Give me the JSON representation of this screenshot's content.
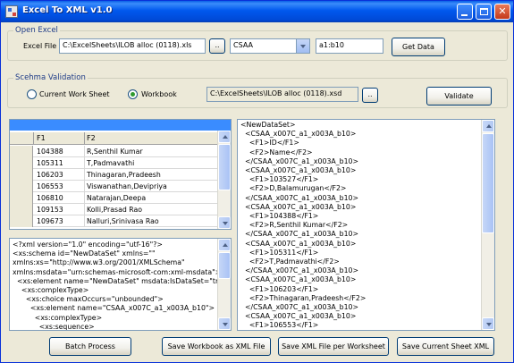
{
  "window": {
    "title": "Excel To XML v1.0"
  },
  "open_excel": {
    "group_title": "Open Excel",
    "file_label": "Excel File",
    "file_path": "C:\\ExcelSheets\\ILOB alloc (0118).xls",
    "browse_label": "..",
    "sheet_selected": "CSAA",
    "range_value": "a1:b10",
    "get_data_label": "Get Data"
  },
  "schema_validation": {
    "group_title": "Scehma Validation",
    "option_current": "Current Work Sheet",
    "option_workbook": "Workbook",
    "selected": "Workbook",
    "xsd_path": "C:\\ExcelSheets\\ILOB alloc (0118).xsd",
    "browse_label": "..",
    "validate_label": "Validate"
  },
  "grid": {
    "columns": [
      "F1",
      "F2"
    ],
    "rows": [
      [
        "104388",
        "R,Senthil Kumar"
      ],
      [
        "105311",
        "T,Padmavathi"
      ],
      [
        "106203",
        "Thinagaran,Pradeesh"
      ],
      [
        "106553",
        "Viswanathan,Devipriya"
      ],
      [
        "106810",
        "Natarajan,Deepa"
      ],
      [
        "109153",
        "Kolli,Prasad Rao"
      ],
      [
        "109673",
        "Nalluri,Srinivasa Rao"
      ]
    ]
  },
  "schema_text": [
    "<?xml version=\"1.0\" encoding=\"utf-16\"?>",
    "<xs:schema id=\"NewDataSet\" xmlns=\"\"",
    "xmlns:xs=\"http://www.w3.org/2001/XMLSchema\"",
    "xmlns:msdata=\"urn:schemas-microsoft-com:xml-msdata\">",
    "  <xs:element name=\"NewDataSet\" msdata:IsDataSet=\"true\">",
    "    <xs:complexType>",
    "      <xs:choice maxOccurs=\"unbounded\">",
    "        <xs:element name=\"CSAA_x007C_a1_x003A_b10\">",
    "          <xs:complexType>",
    "            <xs:sequence>"
  ],
  "xml_text": [
    "<NewDataSet>",
    "  <CSAA_x007C_a1_x003A_b10>",
    "    <F1>ID</F1>",
    "    <F2>Name</F2>",
    "  </CSAA_x007C_a1_x003A_b10>",
    "  <CSAA_x007C_a1_x003A_b10>",
    "    <F1>103527</F1>",
    "    <F2>D,Balamurugan</F2>",
    "  </CSAA_x007C_a1_x003A_b10>",
    "  <CSAA_x007C_a1_x003A_b10>",
    "    <F1>104388</F1>",
    "    <F2>R,Senthil Kumar</F2>",
    "  </CSAA_x007C_a1_x003A_b10>",
    "  <CSAA_x007C_a1_x003A_b10>",
    "    <F1>105311</F1>",
    "    <F2>T,Padmavathi</F2>",
    "  </CSAA_x007C_a1_x003A_b10>",
    "  <CSAA_x007C_a1_x003A_b10>",
    "    <F1>106203</F1>",
    "    <F2>Thinagaran,Pradeesh</F2>",
    "  </CSAA_x007C_a1_x003A_b10>",
    "  <CSAA_x007C_a1_x003A_b10>",
    "    <F1>106553</F1>"
  ],
  "actions": {
    "batch_process": "Batch Process",
    "save_workbook": "Save Workbook as XML File",
    "save_per_sheet": "Save XML File per Worksheet",
    "save_current": "Save Current Sheet XML"
  }
}
